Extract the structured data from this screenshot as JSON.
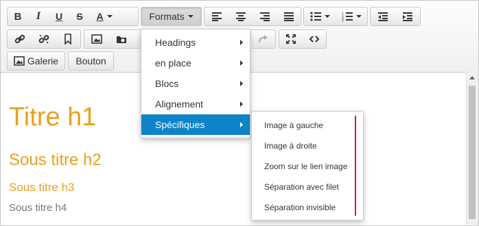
{
  "toolbar": {
    "formats_label": "Formats",
    "galerie_label": "Galerie",
    "bouton_label": "Bouton"
  },
  "formats_menu": {
    "items": [
      {
        "label": "Headings"
      },
      {
        "label": "en place"
      },
      {
        "label": "Blocs"
      },
      {
        "label": "Alignement"
      },
      {
        "label": "Spécifiques",
        "selected": true
      }
    ]
  },
  "specifiques_menu": {
    "items": [
      {
        "label": "Image à gauche"
      },
      {
        "label": "Image à droite"
      },
      {
        "label": "Zoom sur le lien image"
      },
      {
        "label": "Séparation avec filet"
      },
      {
        "label": "Séparation invisible"
      }
    ]
  },
  "content": {
    "h1": "Titre h1",
    "h2": "Sous titre h2",
    "h3": "Sous titre h3",
    "h4": "Sous titre h4"
  },
  "colors": {
    "accent": "#e8a021",
    "selected": "#0d84c9",
    "divider": "#d4174b"
  }
}
